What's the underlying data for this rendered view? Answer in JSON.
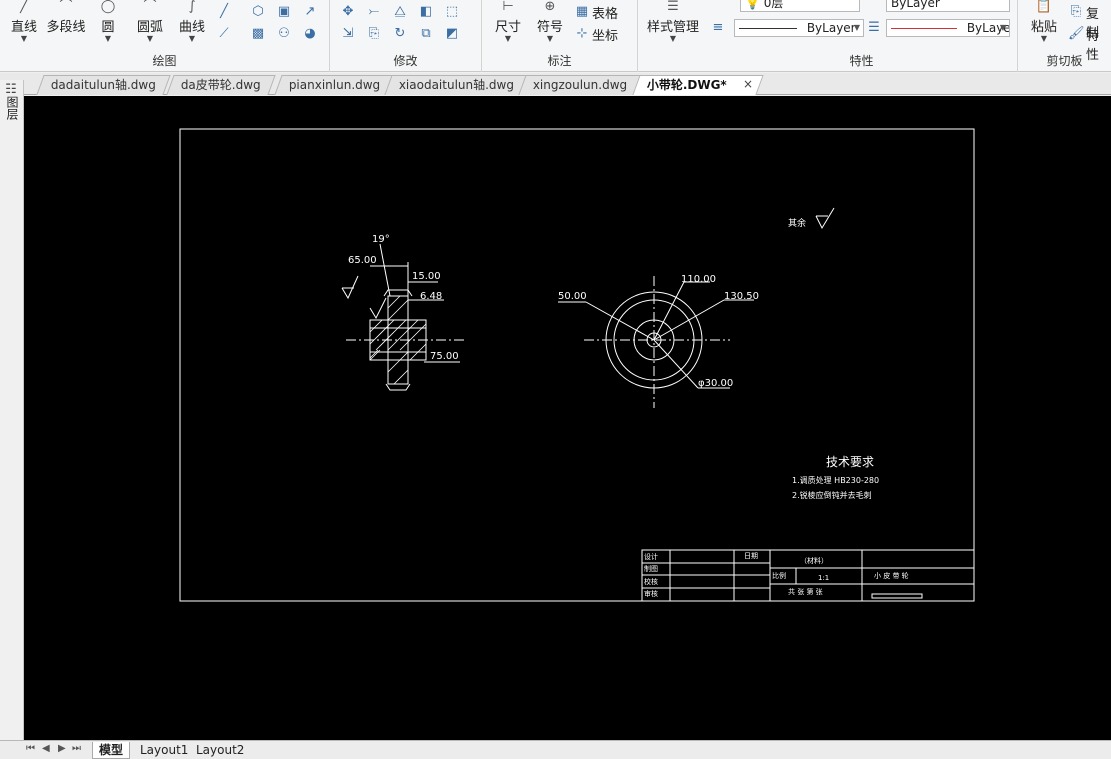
{
  "ribbon": {
    "draw": {
      "title": "绘图",
      "line": "直线",
      "polyline": "多段线",
      "circle": "圆",
      "arc": "圆弧",
      "curve": "曲线"
    },
    "modify": {
      "title": "修改"
    },
    "annotation": {
      "title": "标注",
      "dimension": "尺寸",
      "symbol": "符号",
      "table": "表格",
      "coordinate": "坐标"
    },
    "style": {
      "label": "样式管理"
    },
    "properties": {
      "title": "特性",
      "layer_value": "0层",
      "color_value": "ByLayer",
      "linetype_value": "ByLayer",
      "lineweight_value": "ByLayer"
    },
    "clipboard": {
      "title": "剪切板",
      "paste": "粘贴",
      "copy": "复制",
      "match": "特性"
    }
  },
  "tabs": [
    {
      "label": "dadaitulun轴.dwg"
    },
    {
      "label": "da皮带轮.dwg"
    },
    {
      "label": "pianxinlun.dwg"
    },
    {
      "label": "xiaodaitulun轴.dwg"
    },
    {
      "label": "xingzoulun.dwg"
    },
    {
      "label": "小带轮.DWG*"
    }
  ],
  "tab_close": "×",
  "side_palette": {
    "label": "图层"
  },
  "drawing": {
    "dims": {
      "angle": "19°",
      "d65": "65.00",
      "d15": "15.00",
      "d648": "6.48",
      "d75": "75.00",
      "d50": "50.00",
      "d110": "110.00",
      "d1305": "130.50",
      "d30": "φ30.00"
    },
    "roughness_rest": "其余",
    "tech": {
      "title": "技术要求",
      "line1": "1.调质处理 HB230-280",
      "line2": "2.锐棱应倒钝并去毛刺"
    },
    "titleblock": {
      "design": "设计",
      "draw": "制图",
      "check": "校核",
      "approve": "审核",
      "date": "日期",
      "material": "（材料）",
      "scale_label": "比例",
      "scale_value": "1:1",
      "part_name": "小 皮 带 轮",
      "sheets": "共 张  第 张"
    }
  },
  "layout_tabs": [
    {
      "label": "模型"
    },
    {
      "label": "Layout1"
    },
    {
      "label": "Layout2"
    }
  ],
  "nav": {
    "first": "⏮",
    "prev": "◀",
    "next": "▶",
    "last": "⏭"
  }
}
